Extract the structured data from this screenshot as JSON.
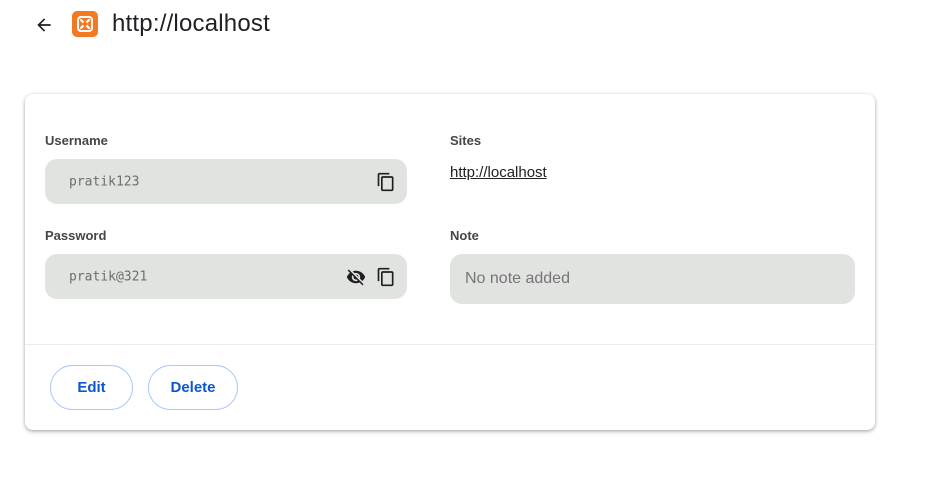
{
  "header": {
    "title": "http://localhost",
    "back_icon": "arrow-back-icon",
    "logo_icon": "xampp-logo-icon",
    "logo_color": "#f37a22"
  },
  "credential": {
    "username": {
      "label": "Username",
      "value": "pratik123",
      "copy_icon": "copy-icon"
    },
    "password": {
      "label": "Password",
      "value": "pratik@321",
      "visibility_icon": "eye-off-icon",
      "copy_icon": "copy-icon"
    },
    "sites": {
      "label": "Sites",
      "link": "http://localhost"
    },
    "note": {
      "label": "Note",
      "placeholder": "No note added"
    }
  },
  "actions": {
    "edit_label": "Edit",
    "delete_label": "Delete"
  },
  "colors": {
    "field_background": "#e1e3e1",
    "button_text": "#0b57d0",
    "button_border": "#a8c7fa"
  }
}
